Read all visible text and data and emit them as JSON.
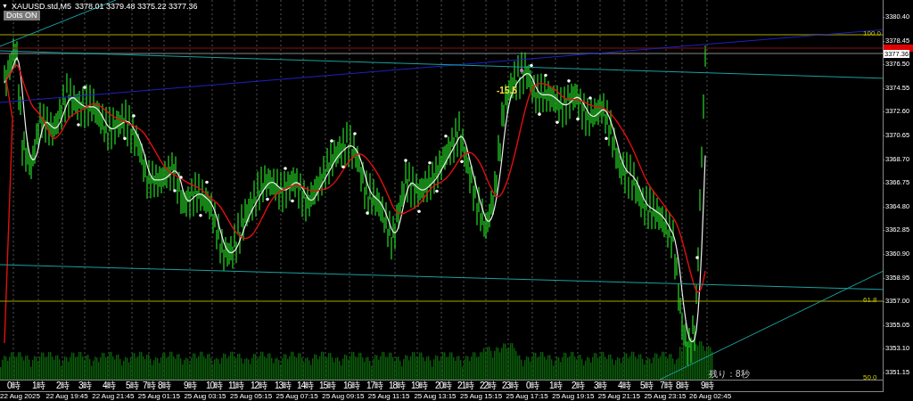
{
  "header": {
    "glyph": "▼",
    "symbol": "XAUUSD.std,M5",
    "ohlc": "3378.01 3379.48 3375.22 3377.36"
  },
  "dots_button": {
    "label": "Dots",
    "state": "ON"
  },
  "price_axis": [
    "3380.40",
    "3378.45",
    "3376.50",
    "3374.55",
    "3372.60",
    "3370.65",
    "3368.70",
    "3366.75",
    "3364.80",
    "3362.85",
    "3360.90",
    "3358.95",
    "3357.00",
    "3355.05",
    "3353.10",
    "3351.15"
  ],
  "current_price": "3377.36",
  "fib_levels": [
    "100.0",
    "61.8",
    "50.0"
  ],
  "annotation": "-15.5",
  "countdown": "残り：8秒",
  "hour_labels": [
    "0時",
    "1時",
    "2時",
    "3時",
    "4時",
    "5時",
    "7時",
    "8時",
    "9時",
    "10時",
    "11時",
    "12時",
    "13時",
    "14時",
    "15時",
    "16時",
    "17時",
    "18時",
    "19時",
    "20時",
    "21時",
    "22時",
    "23時",
    "0時",
    "1時",
    "2時",
    "3時",
    "4時",
    "5時",
    "7時",
    "8時",
    "9時"
  ],
  "date_labels": [
    "22 Aug 2025",
    "22 Aug 19:45",
    "22 Aug 21:45",
    "25 Aug 01:15",
    "25 Aug 03:15",
    "25 Aug 05:15",
    "25 Aug 07:15",
    "25 Aug 09:15",
    "25 Aug 11:15",
    "25 Aug 13:15",
    "25 Aug 15:15",
    "25 Aug 17:15",
    "25 Aug 19:15",
    "25 Aug 21:15",
    "25 Aug 23:15",
    "26 Aug 02:45"
  ]
}
